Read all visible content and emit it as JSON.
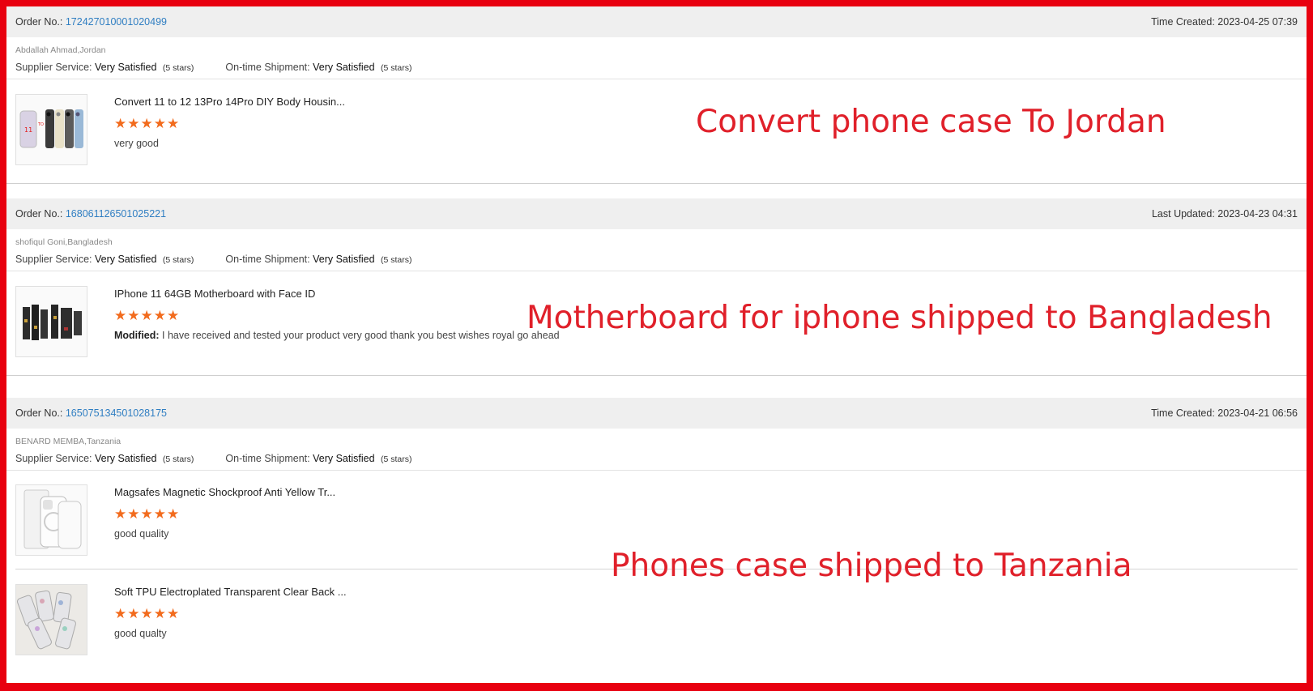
{
  "labels": {
    "order_no": "Order No.:",
    "supplier_service": "Supplier Service:",
    "ontime_shipment": "On-time Shipment:",
    "modified": "Modified:"
  },
  "orders": [
    {
      "order_no": "172427010001020499",
      "time_label": "Time Created:",
      "time": "2023-04-25 07:39",
      "buyer": "Abdallah Ahmad,Jordan",
      "supplier_rating": "Very Satisfied",
      "supplier_stars": "(5 stars)",
      "shipment_rating": "Very Satisfied",
      "shipment_stars": "(5 stars)",
      "items": [
        {
          "name": "Convert 11 to 12 13Pro 14Pro DIY Body Housin...",
          "rating": 5,
          "stars": "★★★★★",
          "comment": "very good"
        }
      ],
      "annotation": "Convert phone case To Jordan"
    },
    {
      "order_no": "168061126501025221",
      "time_label": "Last Updated:",
      "time": "2023-04-23 04:31",
      "buyer": "shofiqul Goni,Bangladesh",
      "supplier_rating": "Very Satisfied",
      "supplier_stars": "(5 stars)",
      "shipment_rating": "Very Satisfied",
      "shipment_stars": "(5 stars)",
      "items": [
        {
          "name": "IPhone 11 64GB Motherboard with Face ID",
          "rating": 5,
          "stars": "★★★★★",
          "comment": "I have received and tested your product very good thank you best wishes royal go ahead"
        }
      ],
      "annotation": "Motherboard for iphone shipped to  Bangladesh"
    },
    {
      "order_no": "165075134501028175",
      "time_label": "Time Created:",
      "time": "2023-04-21 06:56",
      "buyer": "BENARD MEMBA,Tanzania",
      "supplier_rating": "Very Satisfied",
      "supplier_stars": "(5 stars)",
      "shipment_rating": "Very Satisfied",
      "shipment_stars": "(5 stars)",
      "items": [
        {
          "name": "Magsafes Magnetic Shockproof Anti Yellow Tr...",
          "rating": 5,
          "stars": "★★★★★",
          "comment": "good quality"
        },
        {
          "name": "Soft TPU Electroplated Transparent Clear Back ...",
          "rating": 5,
          "stars": "★★★★★",
          "comment": "good qualty"
        }
      ],
      "annotation": "Phones case shipped to Tanzania"
    }
  ],
  "colors": {
    "frame": "#e8000f",
    "annotation": "#e0202a",
    "order_link": "#2f7ec2",
    "star": "#f26b1d"
  }
}
